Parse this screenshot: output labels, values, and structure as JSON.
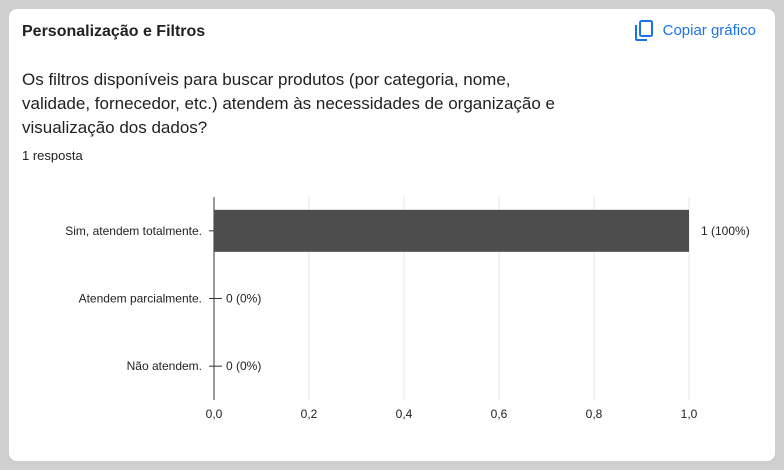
{
  "section": {
    "title": "Personalização e Filtros"
  },
  "actions": {
    "copy_label": "Copiar gráfico"
  },
  "question": {
    "text": "Os filtros disponíveis para buscar produtos (por categoria, nome, validade, fornecedor, etc.) atendem às necessidades de organização e visualização dos dados?",
    "responses": "1 resposta"
  },
  "icons": {
    "copy": "copy-icon"
  },
  "colors": {
    "bar": "#4d4d4d",
    "accent": "#1a73e8"
  },
  "chart_data": {
    "type": "bar",
    "orientation": "horizontal",
    "categories": [
      "Sim, atendem totalmente.",
      "Atendem parcialmente.",
      "Não atendem."
    ],
    "values": [
      1,
      0,
      0
    ],
    "data_labels": [
      "1 (100%)",
      "0 (0%)",
      "0 (0%)"
    ],
    "xlim": [
      0,
      1
    ],
    "x_ticks": [
      0,
      0.2,
      0.4,
      0.6,
      0.8,
      1.0
    ],
    "x_tick_labels": [
      "0,0",
      "0,2",
      "0,4",
      "0,6",
      "0,8",
      "1,0"
    ],
    "grid": true,
    "legend": false
  }
}
